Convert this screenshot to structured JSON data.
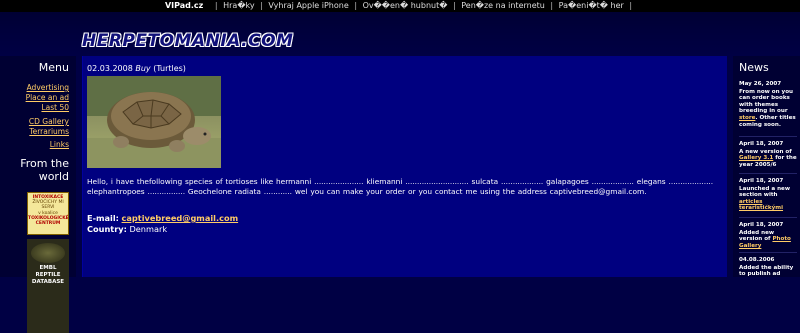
{
  "topbar": {
    "brand": "VIPad.cz",
    "links": [
      "Hra�ky",
      "Vyhraj Apple iPhone",
      "Ov��en� hubnut�",
      "Pen�ze na internetu",
      "Pa�eni�t� her"
    ]
  },
  "header": {
    "logo_text": "HERPETOMANIA.COM"
  },
  "left": {
    "menu_title": "Menu",
    "links": [
      "Advertising",
      "Place an ad",
      "Last 50",
      "CD Gallery",
      "Terrariums",
      "Links"
    ],
    "from_world": "From the world",
    "badge1_lines": [
      "INTOXIKACE",
      "ŽIVOČICHY MI",
      "SERVI",
      "v koalice",
      "TOXIKOLOGICKÉ",
      "CENTRUM"
    ],
    "badge2_lines": [
      "EMBL REPTILE",
      "DATABASE"
    ]
  },
  "main": {
    "date": "02.03.2008",
    "category": "Buy",
    "subcategory": "(Turtles)",
    "photo_alt": "tortoise",
    "body_text": "Hello, i have thefollowing species of tortioses like hermanni ..................... kliemanni ........................... sulcata .................. galapagoes .................. elegans ................... elephantropoes ................ Geochelone radiata ............ wel you can make your order or you contact me using the address captivebreed@gmail.com.",
    "email_label": "E-mail:",
    "email_value": "captivebreed@gmail.com",
    "country_label": "Country:",
    "country_value": "Denmark"
  },
  "right": {
    "news_title": "News",
    "items": [
      {
        "date": "May 26, 2007",
        "text_before": "From now on you can order books with themes breeding in our",
        "link": "store",
        "text_after": ". Other titles coming soon."
      },
      {
        "date": "April 18, 2007",
        "text_before": "A new version of",
        "link": "Gallery 3.1",
        "text_after": "for the year 2005/6"
      },
      {
        "date": "April 18, 2007",
        "text_before": "Launched a new section with",
        "link": "articles terarističkými",
        "text_after": ""
      },
      {
        "date": "April 18, 2007",
        "text_before": "Added new version of",
        "link": "Photo Gallery",
        "text_after": ""
      },
      {
        "date": "04.08.2006",
        "text_before": "Added the ability to publish ad",
        "link": "",
        "text_after": ""
      }
    ]
  }
}
